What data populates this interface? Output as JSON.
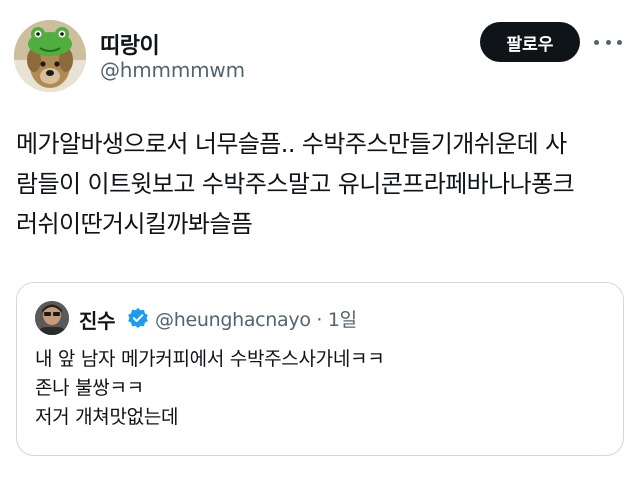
{
  "author": {
    "display_name": "띠랑이",
    "handle": "@hmmmmwm",
    "avatar_icon": "dog-with-frog-hat-avatar"
  },
  "actions": {
    "follow_label": "팔로우",
    "more_icon": "more-horizontal-icon"
  },
  "tweet": {
    "lines": [
      "메가알바생으로서 너무슬픔.. 수박주스만들기개쉬운데 사",
      "람들이 이트윗보고 수박주스말고 유니콘프라페바나나퐁크",
      "러쉬이딴거시킬까봐슬픔"
    ]
  },
  "quoted": {
    "display_name": "진수",
    "handle_time": "@heunghacnayo · 1일",
    "verified_icon": "verified-badge-icon",
    "lines": [
      "내 앞 남자 메가커피에서 수박주스사가네ㅋㅋ",
      "존나 불쌍ㅋㅋ",
      "저거 개쳐맛없는데"
    ]
  },
  "colors": {
    "text": "#0f1419",
    "secondary": "#536471",
    "border": "#cfd9de",
    "verified": "#1d9bf0",
    "button_bg": "#0f1419"
  }
}
